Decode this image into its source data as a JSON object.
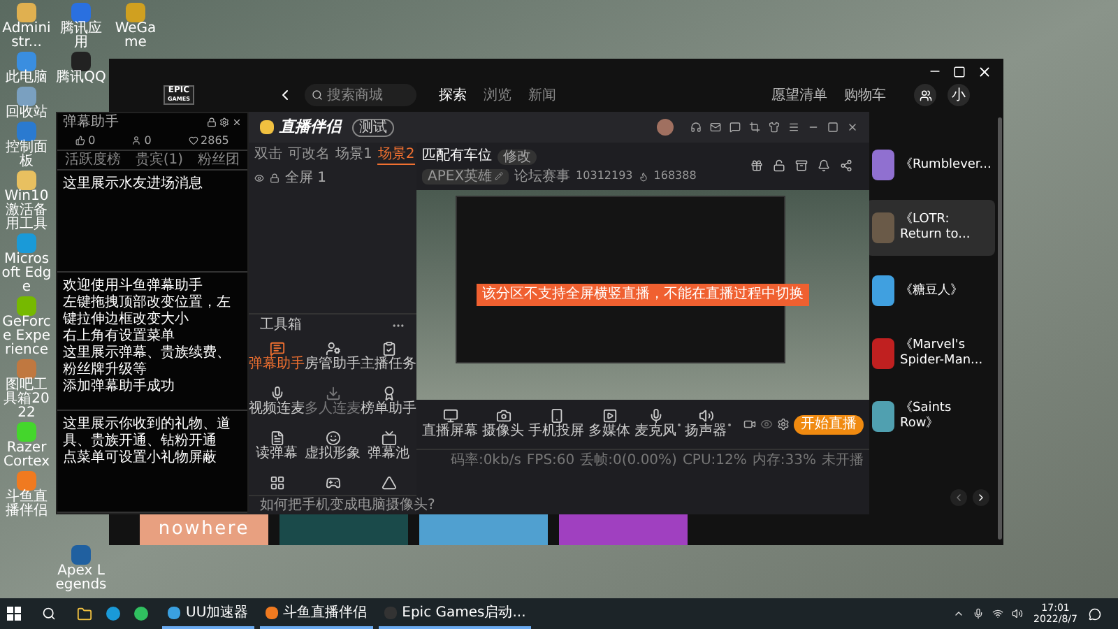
{
  "desktop": {
    "columns": [
      {
        "top": [
          {
            "label": "Administr...",
            "kind": "user"
          },
          {
            "label": "此电脑",
            "kind": "pc"
          },
          {
            "label": "回收站",
            "kind": "bin"
          },
          {
            "label": "控制面板",
            "kind": "panel"
          },
          {
            "label": "Win10激活备用工具",
            "kind": "folder"
          },
          {
            "label": "Microsoft Edge",
            "kind": "edge"
          },
          {
            "label": "GeForce Experience",
            "kind": "nvidia"
          },
          {
            "label": "图吧工具箱2022",
            "kind": "box"
          },
          {
            "label": "Razer Cortex",
            "kind": "razer"
          },
          {
            "label": "斗鱼直播伴侣",
            "kind": "douyu"
          }
        ]
      },
      {
        "top": [
          {
            "label": "腾讯应用",
            "kind": "tencent"
          },
          {
            "label": "腾讯QQ",
            "kind": "qq"
          }
        ],
        "bottom": [
          {
            "label": "Apex Legends",
            "kind": "apex"
          }
        ]
      },
      {
        "top": [
          {
            "label": "WeGame",
            "kind": "wegame"
          }
        ]
      }
    ]
  },
  "epic": {
    "logo": [
      "EPIC",
      "GAMES"
    ],
    "search": {
      "placeholder": "搜索商城"
    },
    "tabs": [
      {
        "label": "探索",
        "selected": true
      },
      {
        "label": "浏览",
        "selected": false
      },
      {
        "label": "新闻",
        "selected": false
      }
    ],
    "links": [
      "愿望清单",
      "购物车"
    ],
    "avatar": "小",
    "games": [
      {
        "title": "《Rumblever...",
        "selected": false
      },
      {
        "title": "《LOTR: Return to...",
        "selected": true
      },
      {
        "title": "《糖豆人》",
        "selected": false
      },
      {
        "title": "《Marvel's Spider-Man...",
        "selected": false
      },
      {
        "title": "《Saints Row》",
        "selected": false
      }
    ],
    "shelf": [
      {
        "kind": "text",
        "text": "nowhere"
      },
      {
        "kind": "art"
      },
      {
        "kind": "art"
      },
      {
        "kind": "art"
      }
    ]
  },
  "danmu": {
    "title": "弹幕助手",
    "stats": [
      {
        "kind": "like",
        "value": "0"
      },
      {
        "kind": "user",
        "value": "0"
      },
      {
        "kind": "heart",
        "value": "2865"
      }
    ],
    "tabs": [
      "活跃度榜",
      "贵宾(1)",
      "粉丝团"
    ],
    "sections": [
      [
        "这里展示水友进场消息"
      ],
      [
        "欢迎使用斗鱼弹幕助手",
        "左键拖拽顶部改变位置，左键拉伸边框改变大小",
        "右上角有设置菜单",
        "这里展示弹幕、贵族续费、粉丝牌升级等",
        "添加弹幕助手成功"
      ],
      [
        "这里展示你收到的礼物、道具、贵族开通、钻粉开通",
        "点菜单可设置小礼物屏蔽"
      ]
    ]
  },
  "live": {
    "title": "直播伴侣",
    "badge": "测试",
    "scenes": [
      {
        "label": "双击",
        "selected": false
      },
      {
        "label": "可改名",
        "selected": false
      },
      {
        "label": "场景1",
        "selected": false
      },
      {
        "label": "场景2",
        "selected": true
      }
    ],
    "sources": [
      "全屏 1"
    ],
    "toolbox": {
      "title": "工具箱",
      "tools": [
        {
          "kind": "tool",
          "label": "弹幕助手",
          "selected": true,
          "disabled": false
        },
        {
          "kind": "tool",
          "label": "房管助手",
          "selected": false,
          "disabled": false
        },
        {
          "kind": "tool",
          "label": "主播任务",
          "selected": false,
          "disabled": false
        },
        {
          "kind": "tool",
          "label": "视频连麦",
          "selected": false,
          "disabled": false
        },
        {
          "kind": "tool",
          "label": "多人连麦",
          "selected": false,
          "disabled": true
        },
        {
          "kind": "tool",
          "label": "榜单助手",
          "selected": false,
          "disabled": false
        },
        {
          "kind": "tool",
          "label": "读弹幕",
          "selected": false,
          "disabled": false
        },
        {
          "kind": "tool",
          "label": "虚拟形象",
          "selected": false,
          "disabled": false
        },
        {
          "kind": "tool",
          "label": "弹幕池",
          "selected": false,
          "disabled": false
        },
        {
          "kind": "cut",
          "selected": false,
          "disabled": false
        },
        {
          "kind": "cut",
          "selected": false,
          "disabled": false
        },
        {
          "kind": "cut",
          "selected": false,
          "disabled": false
        }
      ]
    },
    "tip": "如何把手机变成电脑摄像头?",
    "stream": {
      "title": "匹配有车位",
      "edit": "修改",
      "category": "APEX英雄",
      "tag": "论坛赛事",
      "room": "10312193",
      "heat": "168388"
    },
    "toast": "该分区不支持全屏横竖直播，不能在直播过程中切换",
    "controls": [
      {
        "label": "直播屏幕",
        "kind": "plain"
      },
      {
        "label": "摄像头",
        "kind": "plain"
      },
      {
        "label": "手机投屏",
        "kind": "plain"
      },
      {
        "label": "多媒体",
        "kind": "plain"
      },
      {
        "label": "麦克风",
        "kind": "dropdown"
      },
      {
        "label": "扬声器",
        "kind": "dropdown"
      }
    ],
    "start_button": "开始直播",
    "status": [
      "码率:0kb/s",
      "FPS:60",
      "丢帧:0(0.00%)",
      "CPU:12%",
      "内存:33%",
      "未开播"
    ]
  },
  "taskbar": {
    "apps": [
      {
        "label": "UU加速器",
        "kind": "uu"
      },
      {
        "label": "斗鱼直播伴侣",
        "kind": "douyu"
      },
      {
        "label": "Epic Games启动...",
        "kind": "epic"
      }
    ],
    "time": "17:01",
    "date": "2022/8/7"
  }
}
